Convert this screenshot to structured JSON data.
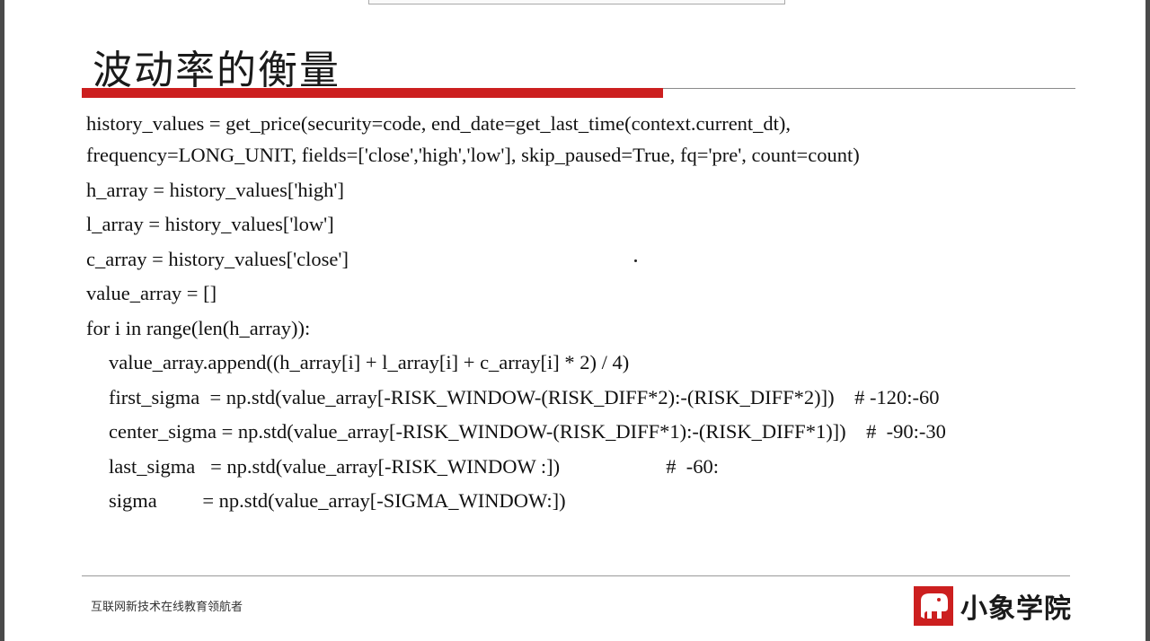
{
  "slide": {
    "title": "波动率的衡量",
    "code_lines": [
      "history_values = get_price(security=code, end_date=get_last_time(context.current_dt),",
      "frequency=LONG_UNIT, fields=['close','high','low'], skip_paused=True, fq='pre', count=count)",
      "h_array = history_values['high']",
      "l_array = history_values['low']",
      "c_array = history_values['close']",
      "value_array = []",
      "for i in range(len(h_array)):",
      "value_array.append((h_array[i] + l_array[i] + c_array[i] * 2) / 4)",
      "first_sigma  = np.std(value_array[-RISK_WINDOW-(RISK_DIFF*2):-(RISK_DIFF*2)])    # -120:-60",
      "center_sigma = np.std(value_array[-RISK_WINDOW-(RISK_DIFF*1):-(RISK_DIFF*1)])    #  -90:-30",
      "last_sigma   = np.std(value_array[-RISK_WINDOW :])                     #  -60:",
      "sigma         = np.std(value_array[-SIGMA_WINDOW:])"
    ]
  },
  "footer": {
    "tagline": "互联网新技术在线教育领航者",
    "logo_text": "小象学院"
  },
  "colors": {
    "accent_red": "#cc1f1f",
    "text": "#111111"
  },
  "icons": {
    "logo_mark": "elephant-logo-icon"
  }
}
